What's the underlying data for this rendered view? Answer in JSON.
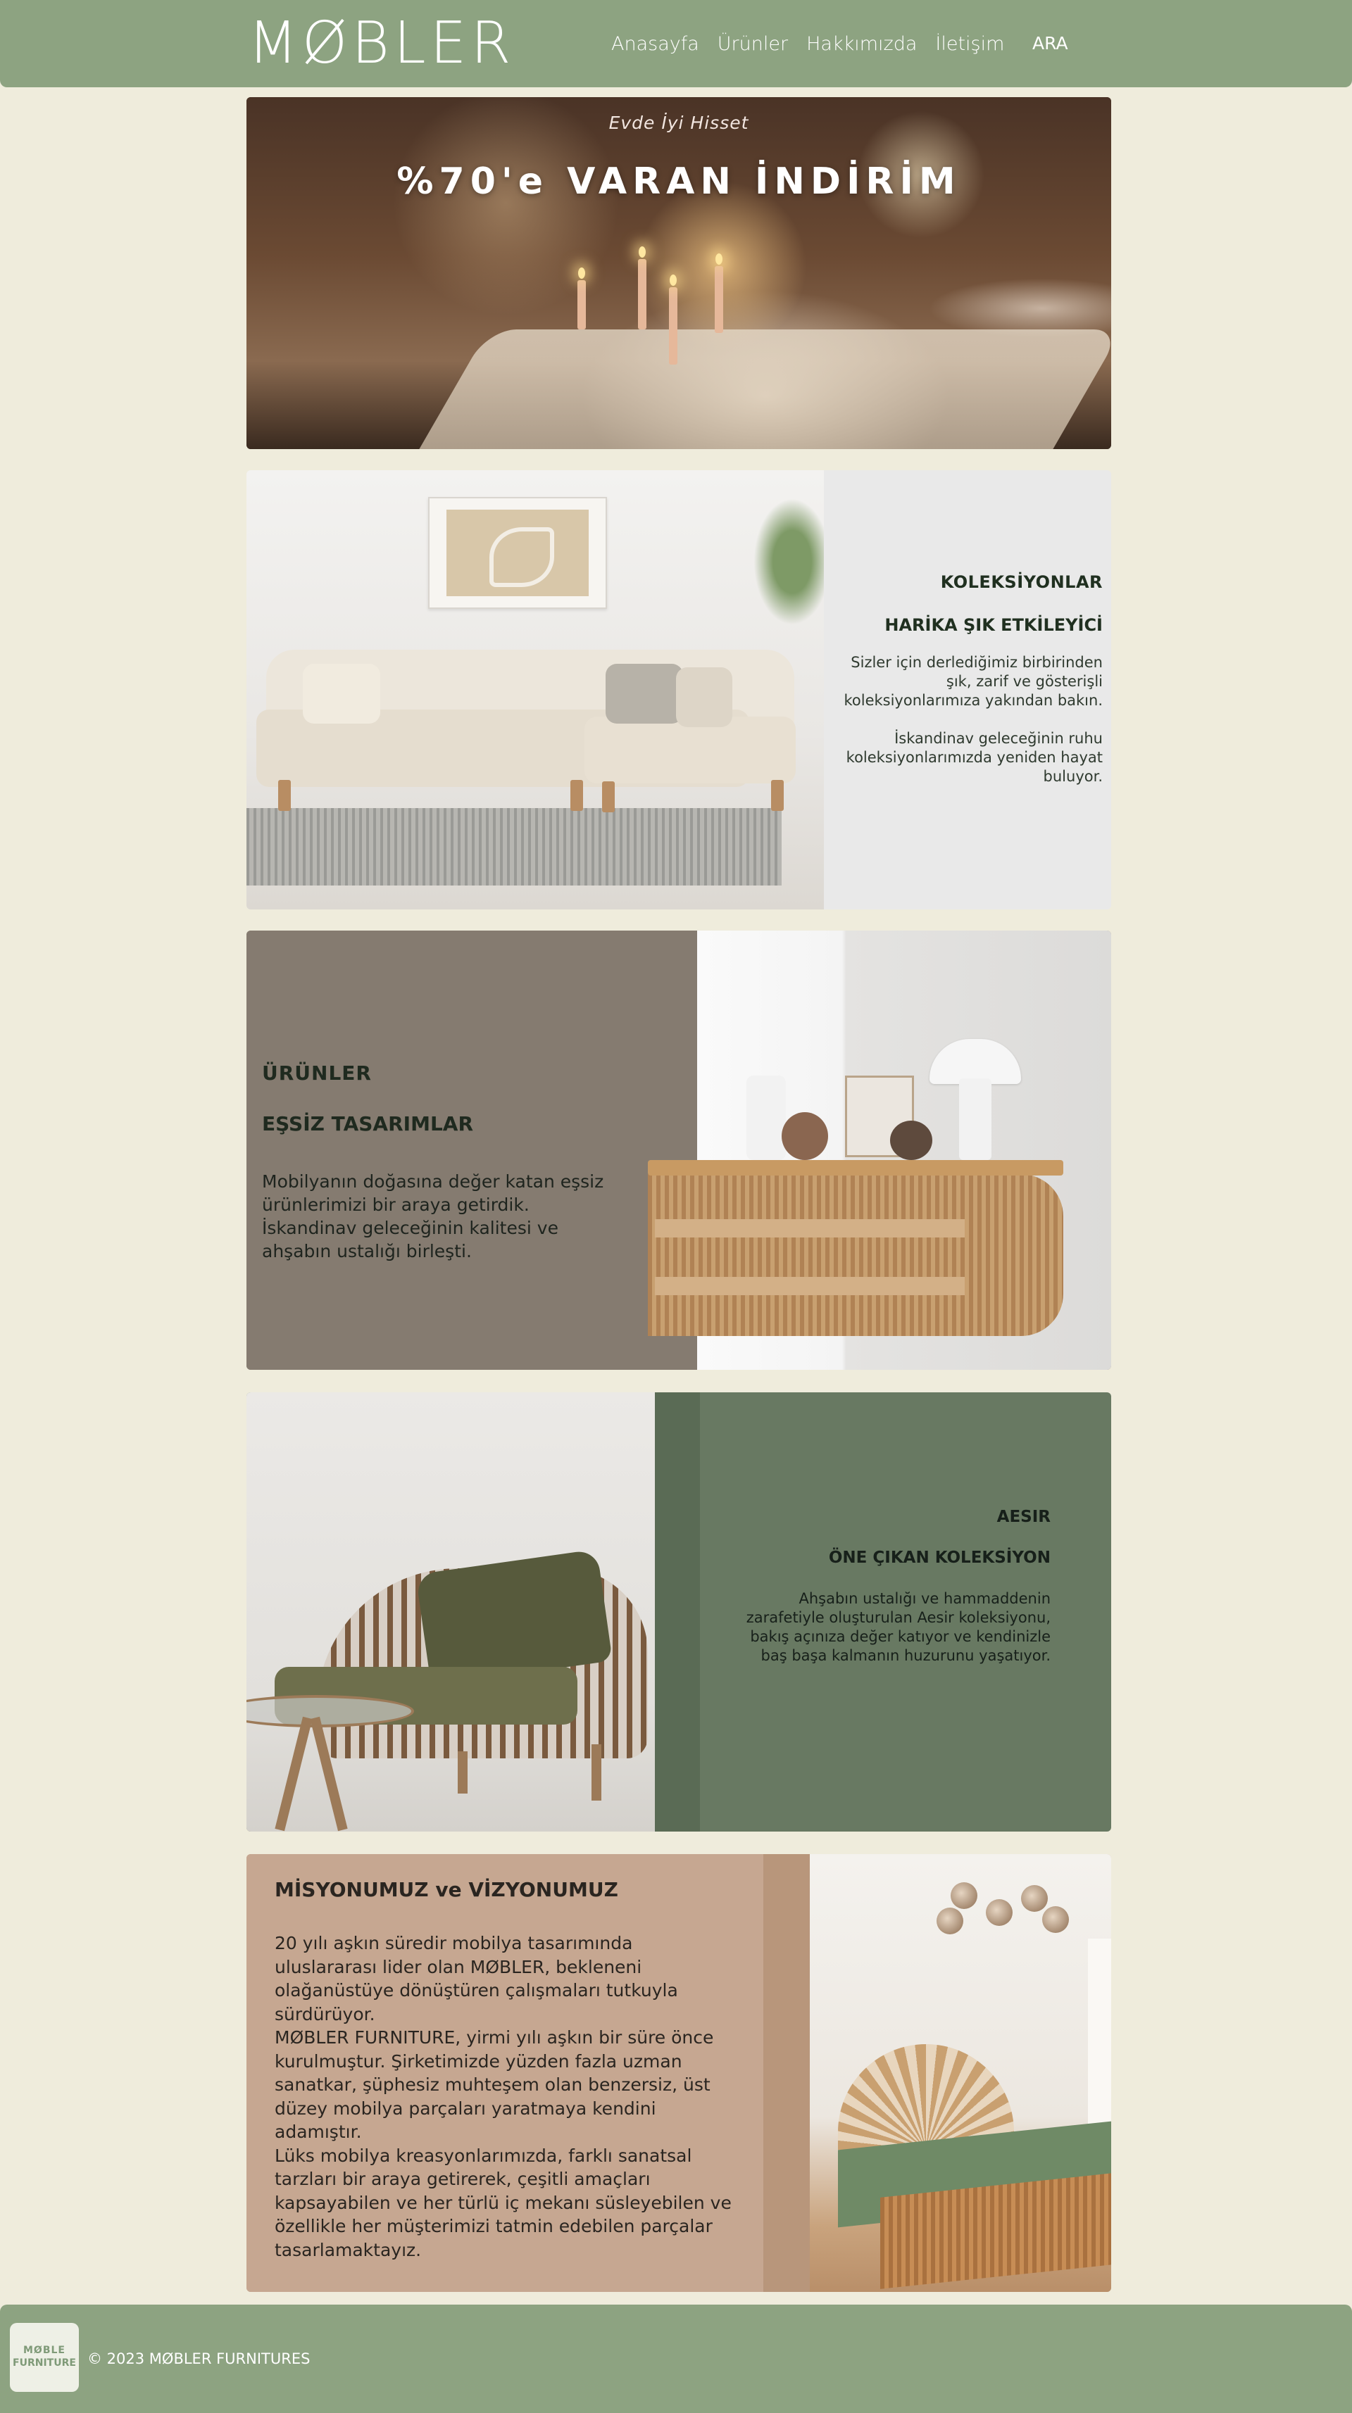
{
  "header": {
    "logo": "MØBLER",
    "nav": [
      "Anasayfa",
      "Ürünler",
      "Hakkımızda",
      "İletişim"
    ],
    "search": "ARA"
  },
  "hero": {
    "tagline": "Evde İyi Hisset",
    "headline": "%70'e VARAN İNDİRİM"
  },
  "collections": {
    "title": "KOLEKSİYONLAR",
    "subtitle": "HARİKA ŞIK ETKİLEYİCİ",
    "paragraph1": "Sizler için derlediğimiz birbirinden şık, zarif ve gösterişli koleksiyonlarımıza yakından bakın.",
    "paragraph2": "İskandinav geleceğinin ruhu koleksiyonlarımızda yeniden hayat buluyor."
  },
  "products": {
    "title": "ÜRÜNLER",
    "subtitle": "EŞSİZ TASARIMLAR",
    "paragraph": "Mobilyanın doğasına değer katan eşsiz ürünlerimizi bir araya getirdik. İskandinav geleceğinin kalitesi ve ahşabın ustalığı birleşti."
  },
  "aesir": {
    "title": "AESIR",
    "subtitle": "ÖNE ÇIKAN KOLEKSİYON",
    "paragraph": "Ahşabın ustalığı ve hammaddenin zarafetiyle oluşturulan Aesir koleksiyonu, bakış açınıza değer katıyor ve kendinizle baş başa kalmanın huzurunu yaşatıyor."
  },
  "mission": {
    "title": "MİSYONUMUZ ve VİZYONUMUZ",
    "paragraph1": "20 yılı aşkın süredir mobilya tasarımında uluslararası lider olan MØBLER, bekleneni olağanüstüye dönüştüren çalışmaları tutkuyla sürdürüyor.",
    "paragraph2": "MØBLER FURNITURE, yirmi yılı aşkın bir süre önce kurulmuştur. Şirketimizde yüzden fazla uzman sanatkar, şüphesiz muhteşem olan benzersiz, üst düzey mobilya parçaları yaratmaya kendini adamıştır.",
    "paragraph3": "Lüks mobilya kreasyonlarımızda, farklı sanatsal tarzları bir araya getirerek, çeşitli amaçları kapsayabilen ve her türlü iç mekanı süsleyebilen ve özellikle her müşterimizi tatmin edebilen parçalar tasarlamaktayız."
  },
  "footer": {
    "logo_line1": "MØBLE",
    "logo_line2": "FURNITURE",
    "copyright": "© 2023 MØBLER FURNITURES"
  },
  "colors": {
    "header_green": "#8da381",
    "page_bg": "#efecdc",
    "products_taupe": "#857b70",
    "aesir_green": "#687962",
    "mission_tan": "#c6a791"
  }
}
